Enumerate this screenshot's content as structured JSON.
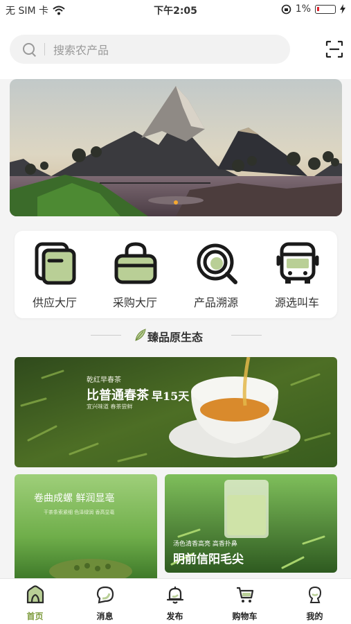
{
  "status_bar": {
    "carrier": "无 SIM 卡",
    "time": "下午2:05",
    "battery": "1%"
  },
  "search": {
    "placeholder": "搜索农产品",
    "icon": "search-icon",
    "scan_icon": "scan-icon"
  },
  "banner": {
    "scene": "mountain-landscape"
  },
  "quick_entries": [
    {
      "label": "供应大厅",
      "icon": "supply-hall-icon"
    },
    {
      "label": "采购大厅",
      "icon": "purchase-bag-icon"
    },
    {
      "label": "产品溯源",
      "icon": "trace-search-icon"
    },
    {
      "label": "源选叫车",
      "icon": "truck-icon"
    }
  ],
  "section": {
    "title": "臻品原生态"
  },
  "promos": {
    "main": {
      "tag": "乾红早春茶",
      "headline": "比普通春茶",
      "badge": "早15天",
      "sub": "宜兴味道 春茶尝鲜"
    },
    "left": {
      "headline": "卷曲成螺  鲜润显亳",
      "sub": "干茶条索紧细 色泽绿润 香高显亳"
    },
    "right": {
      "sub": "汤色清香高亮 高香扑鼻",
      "headline": "明前信阳毛尖"
    }
  },
  "tabs": [
    {
      "label": "首页",
      "icon": "home-icon",
      "active": true
    },
    {
      "label": "消息",
      "icon": "message-icon",
      "active": false
    },
    {
      "label": "发布",
      "icon": "bell-icon",
      "active": false
    },
    {
      "label": "购物车",
      "icon": "cart-icon",
      "active": false
    },
    {
      "label": "我的",
      "icon": "profile-icon",
      "active": false
    }
  ],
  "colors": {
    "accent": "#7d9b3c",
    "icon_fill": "#b9cf96"
  }
}
